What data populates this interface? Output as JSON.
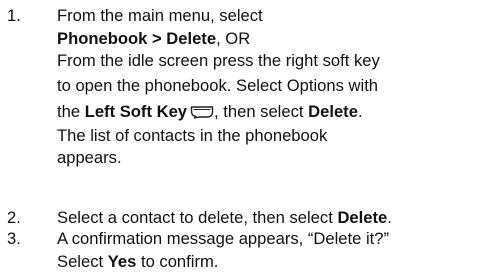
{
  "steps": [
    {
      "number": "1.",
      "line1": "From the main menu, select",
      "line2_bold": "Phonebook > Delete",
      "line2_rest": ", OR",
      "line3": "From the idle screen press the right soft key",
      "line4": "to open the phonebook. Select Options with",
      "line5_pre": "the ",
      "line5_bold": "Left Soft Key",
      "line5_mid": ", then select ",
      "line5_bold2": "Delete",
      "line5_end": ".",
      "line6": "The list of contacts in the phonebook",
      "line7": "appears.",
      "icon": "left-soft-key-icon"
    },
    {
      "number": "2.",
      "text_pre": "Select a contact to delete, then select ",
      "text_bold": "Delete",
      "text_end": "."
    },
    {
      "number": "3.",
      "line1": "A confirmation message appears, “Delete it?”",
      "line2_pre": "Select ",
      "line2_bold": "Yes",
      "line2_end": " to confirm."
    }
  ]
}
